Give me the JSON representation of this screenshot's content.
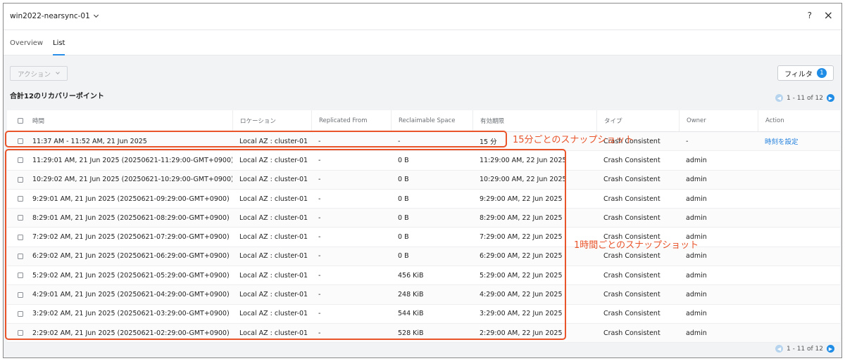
{
  "header": {
    "vm_name": "win2022-nearsync-01",
    "help_label": "?",
    "close_label": "×"
  },
  "tabs": [
    {
      "label": "Overview",
      "active": false
    },
    {
      "label": "List",
      "active": true
    }
  ],
  "toolbar": {
    "action_label": "アクション",
    "filter_label": "フィルタ",
    "filter_count": "1"
  },
  "summary": {
    "total_label": "合計12のリカバリーポイント",
    "pager_text": "1 - 11 of 12"
  },
  "table": {
    "columns": [
      "時間",
      "ロケーション",
      "Replicated From",
      "Reclaimable Space",
      "有効期限",
      "タイプ",
      "Owner",
      "Action"
    ],
    "rows": [
      {
        "time": "11:37 AM - 11:52 AM, 21 Jun 2025",
        "location": "Local AZ : cluster-01",
        "replicated_from": "-",
        "reclaimable": "-",
        "expiry": "15 分",
        "type": "Crash Consistent",
        "owner": "-",
        "action": "時刻を設定"
      },
      {
        "time": "11:29:01 AM, 21 Jun 2025 (20250621-11:29:00-GMT+0900)",
        "location": "Local AZ : cluster-01",
        "replicated_from": "-",
        "reclaimable": "0 B",
        "expiry": "11:29:00 AM, 22 Jun 2025",
        "type": "Crash Consistent",
        "owner": "admin",
        "action": ""
      },
      {
        "time": "10:29:02 AM, 21 Jun 2025 (20250621-10:29:00-GMT+0900)",
        "location": "Local AZ : cluster-01",
        "replicated_from": "-",
        "reclaimable": "0 B",
        "expiry": "10:29:00 AM, 22 Jun 2025",
        "type": "Crash Consistent",
        "owner": "admin",
        "action": ""
      },
      {
        "time": "9:29:01 AM, 21 Jun 2025 (20250621-09:29:00-GMT+0900)",
        "location": "Local AZ : cluster-01",
        "replicated_from": "-",
        "reclaimable": "0 B",
        "expiry": "9:29:00 AM, 22 Jun 2025",
        "type": "Crash Consistent",
        "owner": "admin",
        "action": ""
      },
      {
        "time": "8:29:01 AM, 21 Jun 2025 (20250621-08:29:00-GMT+0900)",
        "location": "Local AZ : cluster-01",
        "replicated_from": "-",
        "reclaimable": "0 B",
        "expiry": "8:29:00 AM, 22 Jun 2025",
        "type": "Crash Consistent",
        "owner": "admin",
        "action": ""
      },
      {
        "time": "7:29:02 AM, 21 Jun 2025 (20250621-07:29:00-GMT+0900)",
        "location": "Local AZ : cluster-01",
        "replicated_from": "-",
        "reclaimable": "0 B",
        "expiry": "7:29:00 AM, 22 Jun 2025",
        "type": "Crash Consistent",
        "owner": "admin",
        "action": ""
      },
      {
        "time": "6:29:02 AM, 21 Jun 2025 (20250621-06:29:00-GMT+0900)",
        "location": "Local AZ : cluster-01",
        "replicated_from": "-",
        "reclaimable": "0 B",
        "expiry": "6:29:00 AM, 22 Jun 2025",
        "type": "Crash Consistent",
        "owner": "admin",
        "action": ""
      },
      {
        "time": "5:29:02 AM, 21 Jun 2025 (20250621-05:29:00-GMT+0900)",
        "location": "Local AZ : cluster-01",
        "replicated_from": "-",
        "reclaimable": "456 KiB",
        "expiry": "5:29:00 AM, 22 Jun 2025",
        "type": "Crash Consistent",
        "owner": "admin",
        "action": ""
      },
      {
        "time": "4:29:01 AM, 21 Jun 2025 (20250621-04:29:00-GMT+0900)",
        "location": "Local AZ : cluster-01",
        "replicated_from": "-",
        "reclaimable": "248 KiB",
        "expiry": "4:29:00 AM, 22 Jun 2025",
        "type": "Crash Consistent",
        "owner": "admin",
        "action": ""
      },
      {
        "time": "3:29:02 AM, 21 Jun 2025 (20250621-03:29:00-GMT+0900)",
        "location": "Local AZ : cluster-01",
        "replicated_from": "-",
        "reclaimable": "544 KiB",
        "expiry": "3:29:00 AM, 22 Jun 2025",
        "type": "Crash Consistent",
        "owner": "admin",
        "action": ""
      },
      {
        "time": "2:29:02 AM, 21 Jun 2025 (20250621-02:29:00-GMT+0900)",
        "location": "Local AZ : cluster-01",
        "replicated_from": "-",
        "reclaimable": "528 KiB",
        "expiry": "2:29:00 AM, 22 Jun 2025",
        "type": "Crash Consistent",
        "owner": "admin",
        "action": ""
      }
    ]
  },
  "annotations": {
    "fifteen_min": "15分ごとのスナップショット",
    "hourly": "1時間ごとのスナップショット",
    "color": "#e9542a"
  },
  "colors": {
    "accent": "#1f8ce6",
    "link": "#1f7fdb"
  }
}
